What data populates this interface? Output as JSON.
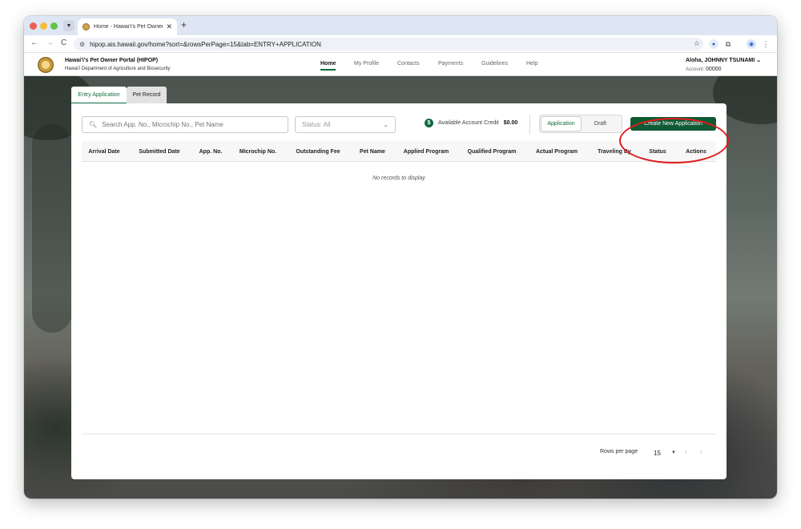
{
  "browser": {
    "tab_title": "Home - Hawai'i's Pet Owner P",
    "url": "hipop.ais.hawaii.gov/home?sort=&rowsPerPage=15&tab=ENTRY+APPLICATION",
    "nav_back": "←",
    "nav_forward": "→",
    "reload": "C",
    "new_tab": "+",
    "tab_close": "✕",
    "star": "☆"
  },
  "header": {
    "title": "Hawai'i's Pet Owner Portal (HIPOP)",
    "subtitle": "Hawai'i Department of Agriculture and Biosecurity",
    "nav": [
      "Home",
      "My Profile",
      "Contacts",
      "Payments",
      "Guidelines",
      "Help"
    ],
    "active_nav": "Home",
    "user_greeting": "Aloha, JOHNNY TSUNAMI ⌄",
    "account_label": "Account:",
    "account_number": "00000"
  },
  "tabs": {
    "entry_application": "Entry Application",
    "pet_record": "Pet Record"
  },
  "toolbar": {
    "search_placeholder": "Search App. No., Microchip No., Pet Name",
    "status_select": "Status: All",
    "credit_label": "Available Account Credit",
    "credit_value": "$0.00",
    "segment_application": "Application",
    "segment_draft": "Draft",
    "create_button": "Create New Application"
  },
  "table": {
    "columns": [
      "Arrival Date",
      "Submitted Date",
      "App. No.",
      "Microchip No.",
      "Outstanding Fee",
      "Pet Name",
      "Applied Program",
      "Qualified Program",
      "Actual Program",
      "Traveling By",
      "Status",
      "Actions"
    ],
    "empty_message": "No records to display"
  },
  "pagination": {
    "rows_per_page_label": "Rows per page",
    "rows_per_page_value": "15",
    "prev": "‹",
    "next": "›"
  },
  "colors": {
    "brand_green": "#0f5a35",
    "annotation_red": "#e11b1b"
  },
  "icons": [
    "search-icon",
    "chevron-down-icon",
    "dollar-icon",
    "star-icon",
    "extensions-icon",
    "profile-icon",
    "menu-icon"
  ]
}
